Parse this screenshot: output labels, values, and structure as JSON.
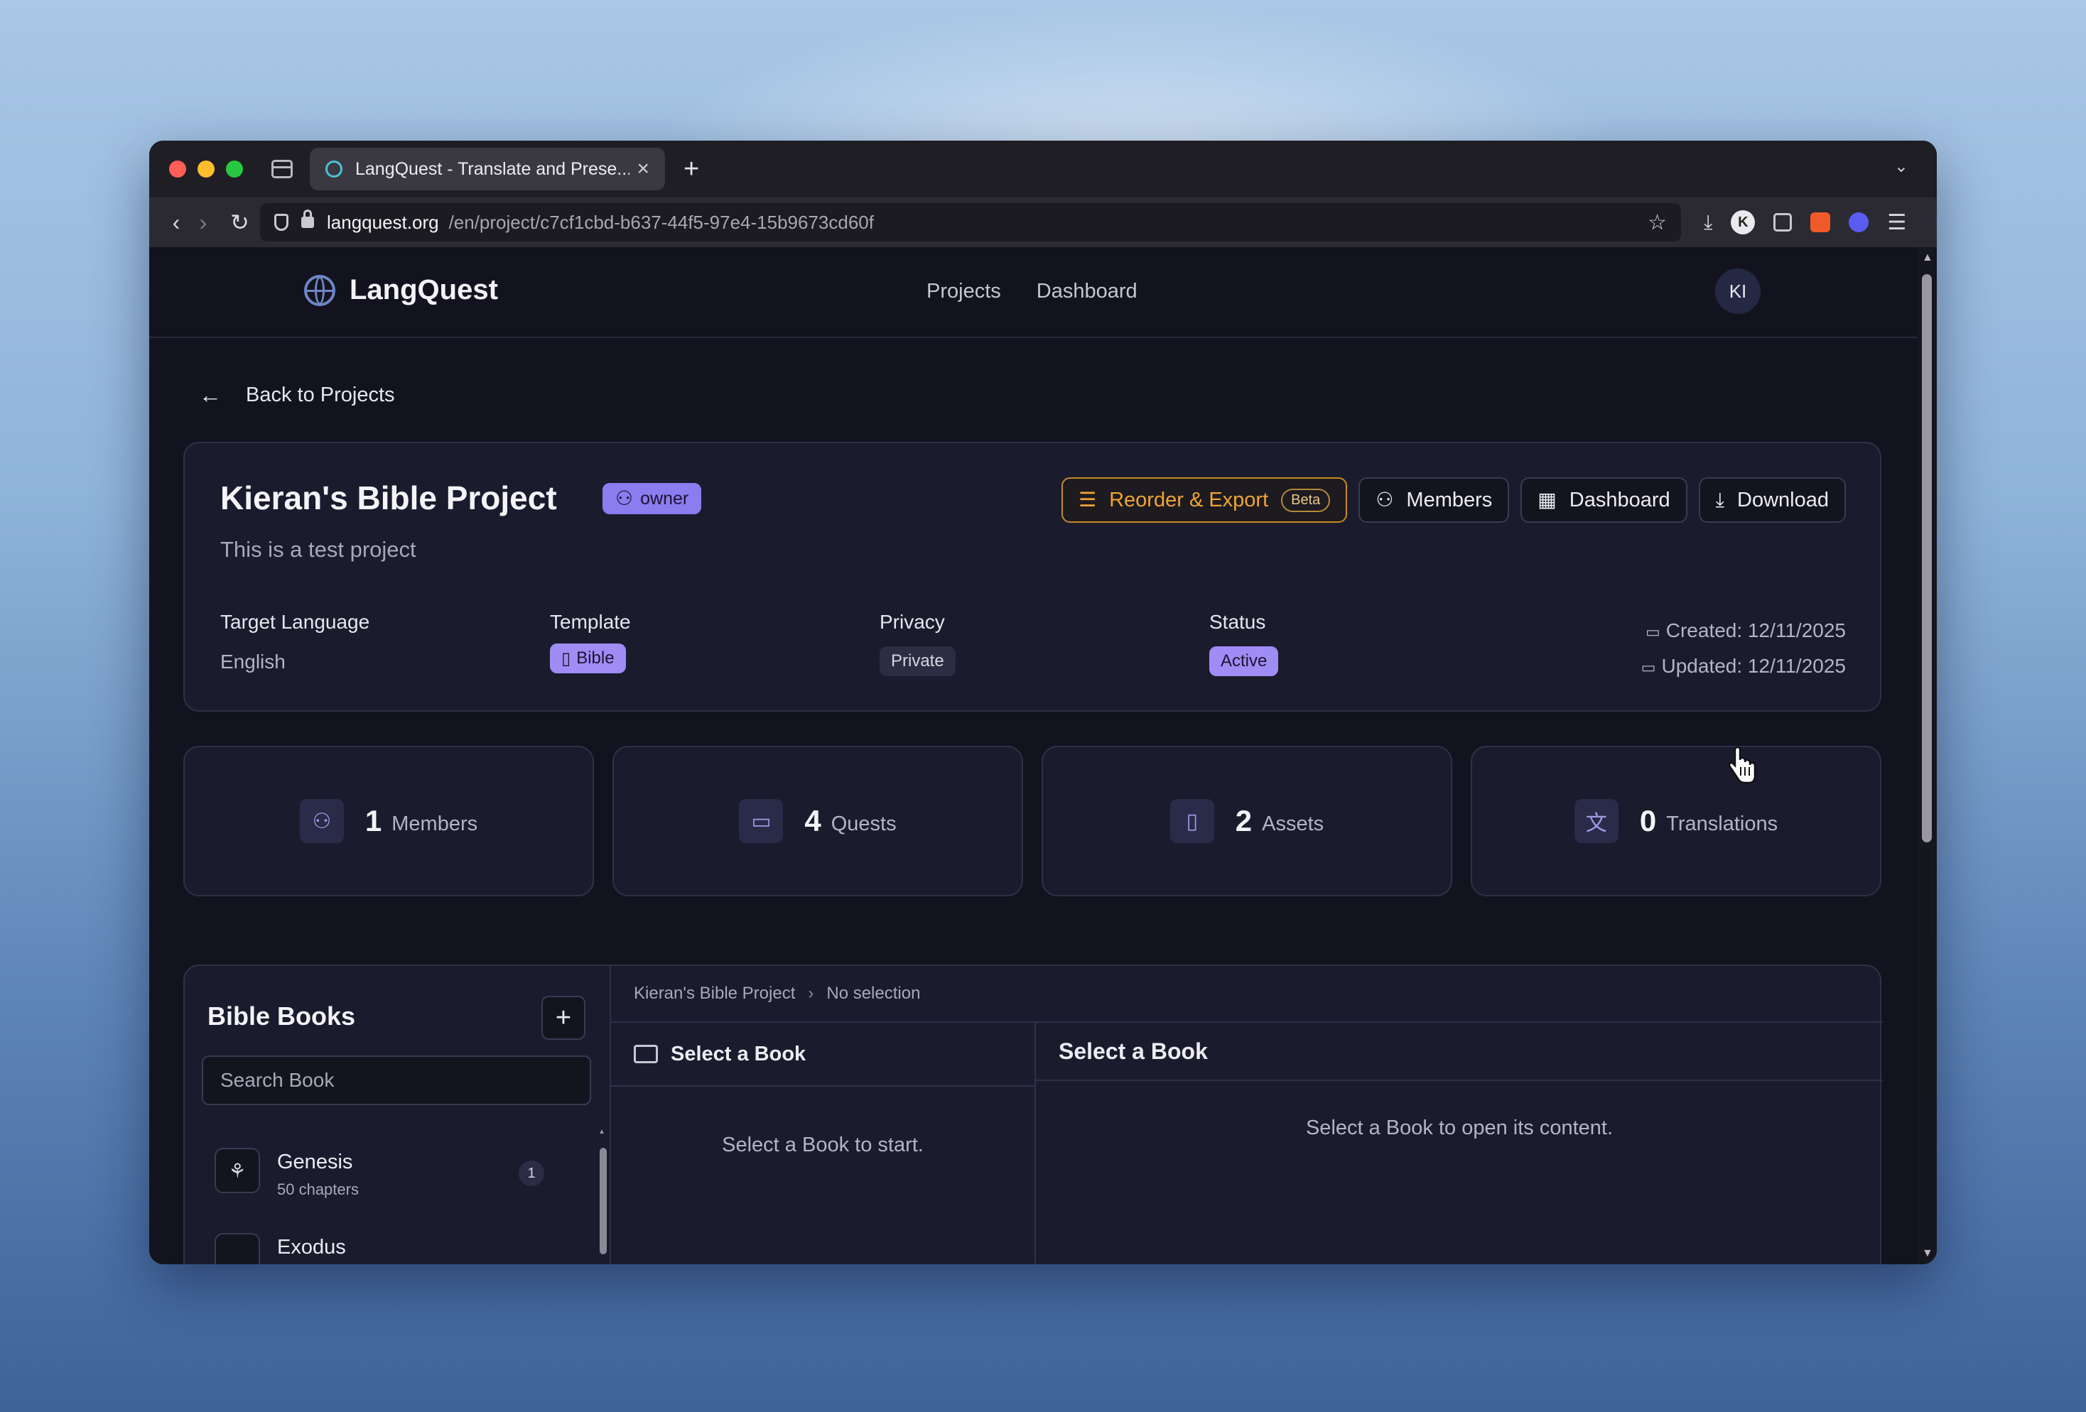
{
  "browser": {
    "tab_title": "LangQuest - Translate and Prese...",
    "tab_close": "×",
    "new_tab": "+",
    "tab_list": "⌄",
    "url_host": "langquest.org",
    "url_path": "/en/project/c7cf1cbd-b637-44f5-97e4-15b9673cd60f",
    "ext_k": "K"
  },
  "header": {
    "brand": "LangQuest",
    "nav": [
      "Projects",
      "Dashboard"
    ],
    "avatar": "KI"
  },
  "back_link": "Back to Projects",
  "project": {
    "title": "Kieran's Bible Project",
    "role_badge": "owner",
    "description": "This is a test project",
    "actions": {
      "reorder_export": "Reorder & Export",
      "beta": "Beta",
      "members": "Members",
      "dashboard": "Dashboard",
      "download": "Download"
    },
    "meta": {
      "target_language_label": "Target Language",
      "target_language": "English",
      "template_label": "Template",
      "template": "Bible",
      "privacy_label": "Privacy",
      "privacy": "Private",
      "status_label": "Status",
      "status": "Active"
    },
    "created": "Created: 12/11/2025",
    "updated": "Updated: 12/11/2025"
  },
  "stats": [
    {
      "value": "1",
      "label": "Members",
      "icon": "users-icon"
    },
    {
      "value": "4",
      "label": "Quests",
      "icon": "folder-icon"
    },
    {
      "value": "2",
      "label": "Assets",
      "icon": "file-icon"
    },
    {
      "value": "0",
      "label": "Translations",
      "icon": "translate-icon"
    }
  ],
  "books": {
    "title": "Bible Books",
    "add": "+",
    "search_placeholder": "Search Book",
    "items": [
      {
        "name": "Genesis",
        "sub": "50 chapters",
        "count": "1"
      },
      {
        "name": "Exodus",
        "sub": "",
        "count": ""
      }
    ]
  },
  "breadcrumb": {
    "project": "Kieran's Bible Project",
    "current": "No selection"
  },
  "middle": {
    "heading": "Select a Book",
    "message": "Select a Book to start."
  },
  "right": {
    "heading": "Select a Book",
    "message": "Select a Book to open its content."
  },
  "colors": {
    "accent": "#8b7cf0",
    "export": "#f0a530",
    "bg": "#13131f"
  }
}
